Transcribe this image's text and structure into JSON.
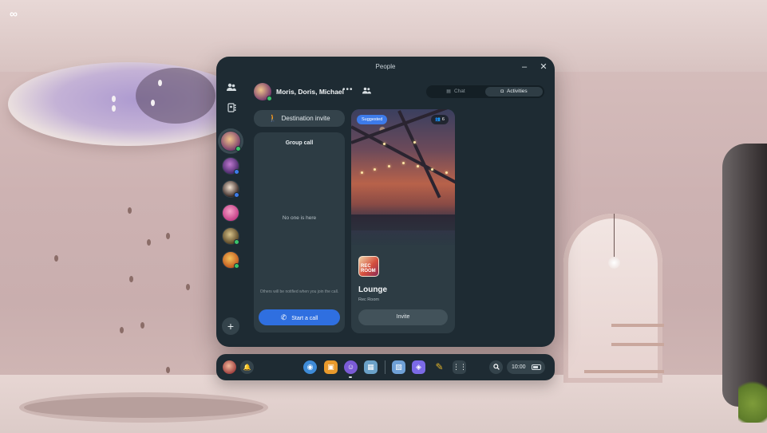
{
  "brand": {
    "logo_text": "∞"
  },
  "window": {
    "title": "People",
    "minimize_label": "–",
    "close_label": "✕"
  },
  "rail": {
    "people_icon": "people-icon",
    "contacts_icon": "contacts-icon",
    "add_label": "+",
    "conversations": [
      {
        "name": "moris-doris-michael",
        "colors": [
          "#f0c58a",
          "#7a3d6c"
        ],
        "status": "#3bc46b",
        "active": true
      },
      {
        "name": "contact-2",
        "colors": [
          "#c07ad0",
          "#4b2a6c"
        ],
        "status": "#3d7bea",
        "active": false
      },
      {
        "name": "contact-3",
        "colors": [
          "#f3e3d2",
          "#3b2a26"
        ],
        "status": "#3d7bea",
        "active": false
      },
      {
        "name": "contact-4",
        "colors": [
          "#f6a2c8",
          "#c43d86"
        ],
        "status": null,
        "active": false
      },
      {
        "name": "contact-5",
        "colors": [
          "#d7c38a",
          "#5b4726"
        ],
        "status": "#3bc46b",
        "active": false
      },
      {
        "name": "contact-6",
        "colors": [
          "#f3c15a",
          "#c25a1f"
        ],
        "status": "#3bc46b",
        "active": false
      }
    ]
  },
  "header": {
    "conversation_name": "Moris, Doris, Michael",
    "more_label": "•••",
    "members_icon": "group-icon",
    "tabs": [
      {
        "label": "Chat",
        "icon": "chat-icon",
        "selected": false
      },
      {
        "label": "Activities",
        "icon": "vr-headset-icon",
        "selected": true
      }
    ]
  },
  "destination": {
    "label": "Destination invite",
    "icon": "person-walking-icon"
  },
  "group_call": {
    "title": "Group call",
    "empty_text": "No one is here",
    "note": "Others will be notified when you join the call.",
    "button_label": "Start a call",
    "button_icon": "phone-icon"
  },
  "activity": {
    "badge": "Suggested",
    "participant_count": "6",
    "app_icon_text": "REC ROOM",
    "name": "Lounge",
    "subtitle": "Rec Room",
    "invite_label": "Invite"
  },
  "taskbar": {
    "time": "10:00",
    "apps": [
      {
        "name": "explore-app",
        "color": "#3e8bd8",
        "glyph": "◉"
      },
      {
        "name": "store-app",
        "color": "#e99a2c",
        "glyph": "▣"
      },
      {
        "name": "people-app",
        "color": "#7a5bd6",
        "glyph": "☺"
      },
      {
        "name": "photos-app",
        "color": "#6aa1c8",
        "glyph": "▦"
      },
      {
        "name": "horizon-app",
        "color": "#6fa0d6",
        "glyph": "▧"
      },
      {
        "name": "messenger-app",
        "color": "#7b6ae6",
        "glyph": "◈"
      },
      {
        "name": "pencil-app",
        "color": "#e4b52a",
        "glyph": "✎"
      },
      {
        "name": "app-library",
        "color": "#34434b",
        "glyph": "⋮⋮"
      }
    ]
  }
}
